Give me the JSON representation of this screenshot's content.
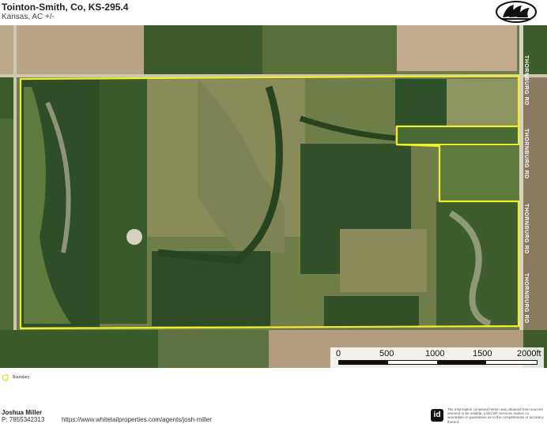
{
  "header": {
    "title": "Tointon-Smith, Co, KS-295.4",
    "subtitle": "Kansas,  AC +/-"
  },
  "map": {
    "road_labels": [
      "THORNBURG RD",
      "THORNBURG RD",
      "THORNBURG RD",
      "THORNBURG RD"
    ],
    "boundary_color": "#f2ee2a"
  },
  "scalebar": {
    "ticks": [
      "0",
      "500",
      "1000",
      "1500",
      "2000ft"
    ]
  },
  "legend": {
    "label": "Boundary",
    "color": "#e6e020"
  },
  "footer": {
    "agent_name": "Joshua Miller",
    "phone": "P: 7855342313",
    "url": "https://www.whitetailproperties.com/agents/josh-miller",
    "id_logo": "id",
    "disclaimer": "The information contained herein was obtained from sources deemed to be reliable. Land id® Services makes no warranties or guarantees as to the completeness or accuracy thereof."
  }
}
